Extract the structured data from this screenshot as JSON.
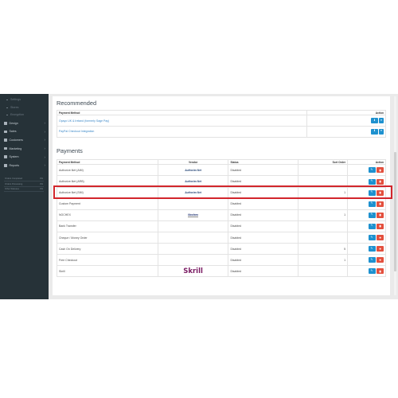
{
  "sidebar": {
    "sub_items": [
      "Settings",
      "Stores",
      "Encryption"
    ],
    "nav_items": [
      {
        "label": "Design",
        "icon": "desktop-icon"
      },
      {
        "label": "Sales",
        "icon": "cart-icon"
      },
      {
        "label": "Customers",
        "icon": "user-icon"
      },
      {
        "label": "Marketing",
        "icon": "share-icon"
      },
      {
        "label": "System",
        "icon": "gear-icon"
      },
      {
        "label": "Reports",
        "icon": "bar-chart-icon"
      }
    ],
    "stats": [
      {
        "label": "Orders Completed",
        "value": "0%"
      },
      {
        "label": "Orders Processing",
        "value": "0%"
      },
      {
        "label": "Other Statuses",
        "value": "0%"
      }
    ]
  },
  "recommended": {
    "title": "Recommended",
    "headers": {
      "method": "Payment Method",
      "action": "Action"
    },
    "rows": [
      {
        "method": "Opayo UK & Ireland (formerly Sage Pay)"
      },
      {
        "method": "PayPal Checkout Integration"
      }
    ]
  },
  "payments": {
    "title": "Payments",
    "headers": {
      "method": "Payment Method",
      "vendor": "Vendor",
      "status": "Status",
      "sort": "Sort Order",
      "action": "Action"
    },
    "rows": [
      {
        "method": "Authorize.Net (AIM)",
        "vendor": "Authorize.Net",
        "vendor_style": "an",
        "status": "Disabled",
        "sort": ""
      },
      {
        "method": "Authorize.Net (ARB)",
        "vendor": "Authorize.Net",
        "vendor_style": "an",
        "status": "Disabled",
        "sort": ""
      },
      {
        "method": "Authorize.Net (SIM)",
        "vendor": "Authorize.Net",
        "vendor_style": "an",
        "status": "Disabled",
        "sort": "1"
      },
      {
        "method": "Custom Payment",
        "vendor": "",
        "vendor_style": "",
        "status": "Disabled",
        "sort": ""
      },
      {
        "method": "NOCHEX",
        "vendor": "Nochex",
        "vendor_style": "nochex",
        "status": "Disabled",
        "sort": "1"
      },
      {
        "method": "Bank Transfer",
        "vendor": "",
        "vendor_style": "",
        "status": "Disabled",
        "sort": ""
      },
      {
        "method": "Cheque / Money Order",
        "vendor": "",
        "vendor_style": "",
        "status": "Disabled",
        "sort": ""
      },
      {
        "method": "Cash On Delivery",
        "vendor": "",
        "vendor_style": "",
        "status": "Disabled",
        "sort": "5"
      },
      {
        "method": "Free Checkout",
        "vendor": "",
        "vendor_style": "",
        "status": "Disabled",
        "sort": "1"
      },
      {
        "method": "Skrill",
        "vendor": "Skrill",
        "vendor_style": "skrill",
        "status": "Disabled",
        "sort": ""
      }
    ]
  },
  "highlight_row": "NOCHEX",
  "colors": {
    "sidebar": "#263238",
    "primary": "#1e91cf",
    "danger": "#e3503e",
    "highlight": "#d2262c"
  }
}
